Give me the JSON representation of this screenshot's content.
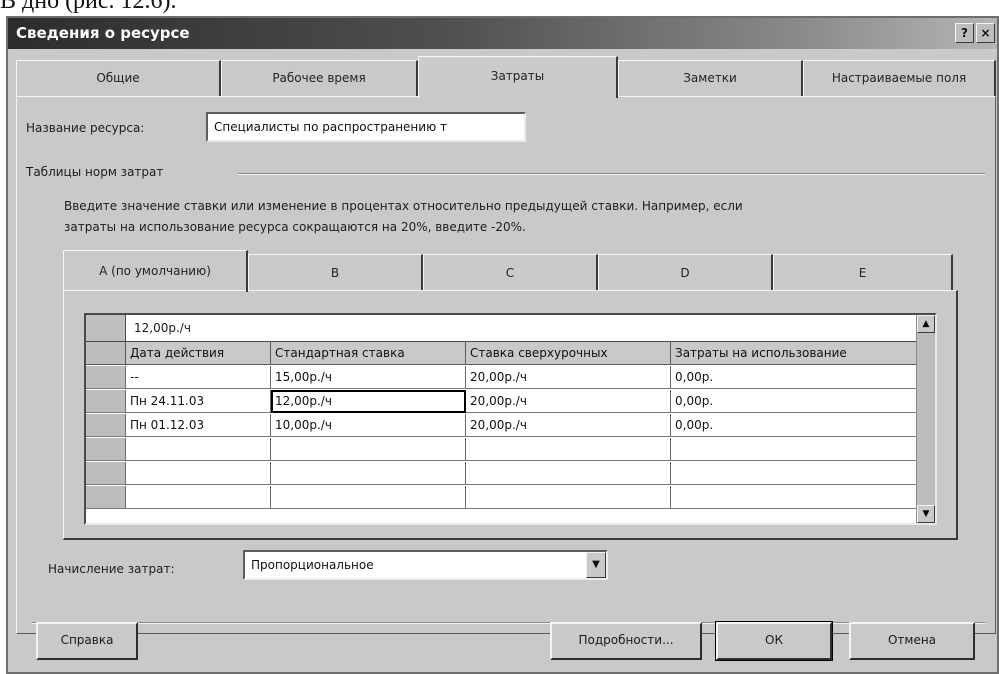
{
  "above_text": "В дно (рис. 12.6).",
  "dialog": {
    "title": "Сведения о ресурсе",
    "title_buttons": {
      "help": "?",
      "close": "×"
    }
  },
  "tabs": [
    "Общие",
    "Рабочее время",
    "Затраты",
    "Заметки",
    "Настраиваемые поля"
  ],
  "active_tab": "Затраты",
  "resource_name": {
    "label": "Название ресурса:",
    "value": "Специалисты по распространению т"
  },
  "cost_tables": {
    "group_label": "Таблицы норм затрат",
    "instructions_line1": "Введите значение ставки или изменение в процентах относительно предыдущей ставки. Например, если",
    "instructions_line2": "затраты на использование ресурса сокращаются на 20%, введите -20%.",
    "tabs": [
      "А (по умолчанию)",
      "B",
      "C",
      "D",
      "E"
    ],
    "active_tab": "А (по умолчанию)",
    "edit_value": "12,00р./ч",
    "columns": [
      "Дата действия",
      "Стандартная ставка",
      "Ставка сверхурочных",
      "Затраты на использование"
    ],
    "rows": [
      [
        "--",
        "15,00р./ч",
        "20,00р./ч",
        "0,00р."
      ],
      [
        "Пн 24.11.03",
        "12,00р./ч",
        "20,00р./ч",
        "0,00р."
      ],
      [
        "Пн 01.12.03",
        "10,00р./ч",
        "20,00р./ч",
        "0,00р."
      ],
      [
        "",
        "",
        "",
        ""
      ],
      [
        "",
        "",
        "",
        ""
      ],
      [
        "",
        "",
        "",
        ""
      ]
    ]
  },
  "cost_accrual": {
    "label": "Начисление затрат:",
    "value": "Пропорциональное"
  },
  "buttons": {
    "help": "Справка",
    "details": "Подробности...",
    "ok": "ОК",
    "cancel": "Отмена"
  }
}
